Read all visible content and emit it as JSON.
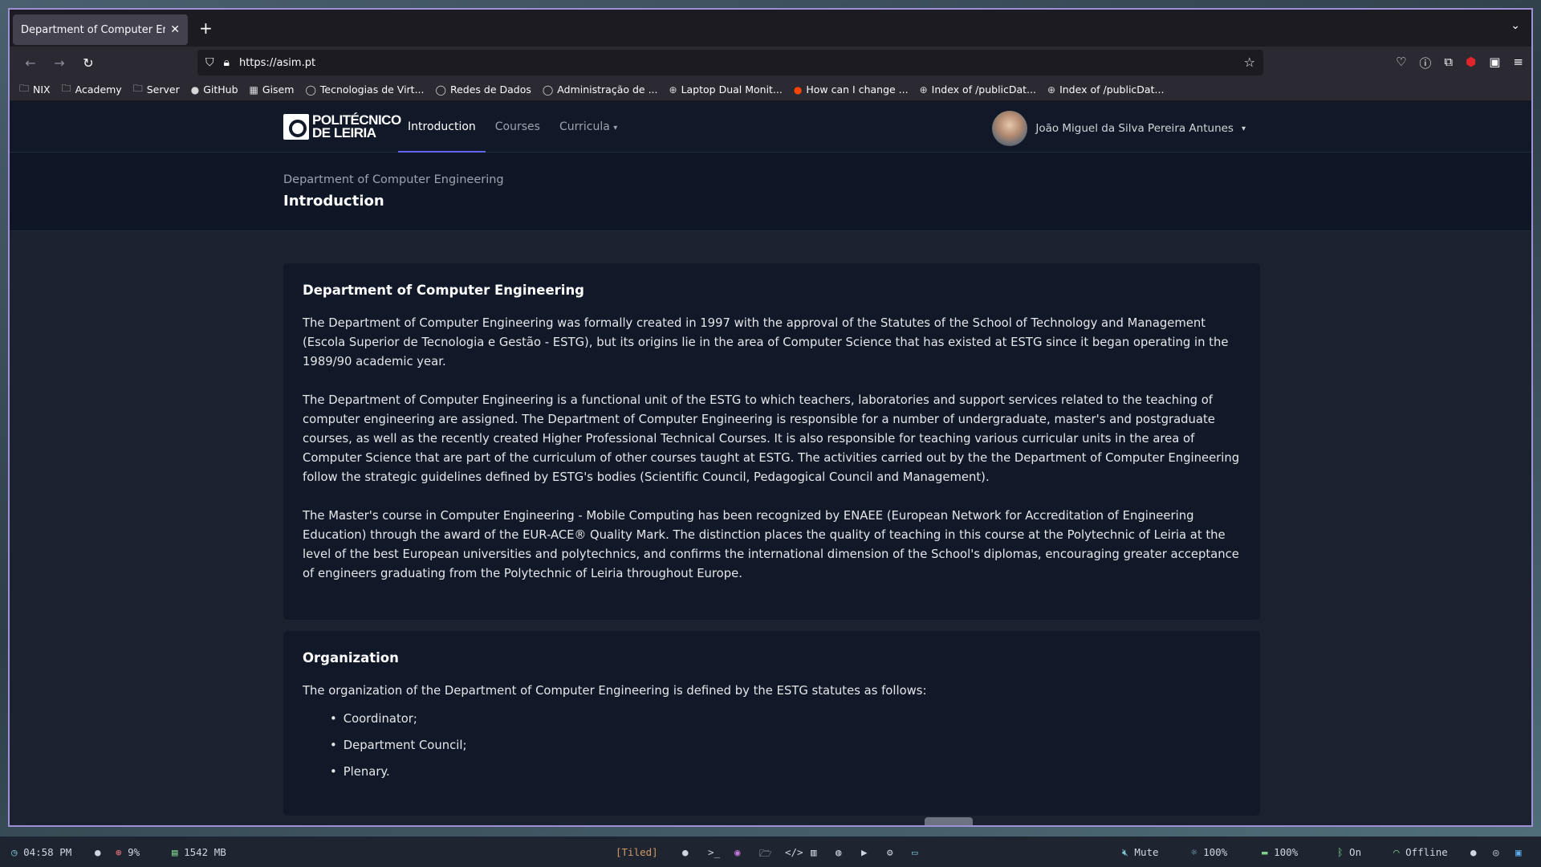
{
  "browser": {
    "tab_title": "Department of Computer Engin",
    "url": "https://asim.pt",
    "bookmarks": [
      {
        "label": "NIX",
        "icon": "folder-icon"
      },
      {
        "label": "Academy",
        "icon": "folder-icon"
      },
      {
        "label": "Server",
        "icon": "folder-icon"
      },
      {
        "label": "GitHub",
        "icon": "github-icon"
      },
      {
        "label": "Gisem",
        "icon": "calendar-icon"
      },
      {
        "label": "Tecnologias de Virt...",
        "icon": "circle-icon"
      },
      {
        "label": "Redes de Dados",
        "icon": "circle-icon"
      },
      {
        "label": "Administração de ...",
        "icon": "circle-icon"
      },
      {
        "label": "Laptop Dual Monit...",
        "icon": "globe-icon"
      },
      {
        "label": "How can I change ...",
        "icon": "reddit-icon"
      },
      {
        "label": "Index of /publicDat...",
        "icon": "globe-icon"
      },
      {
        "label": "Index of /publicDat...",
        "icon": "globe-icon"
      }
    ]
  },
  "site": {
    "logo_line1": "POLITÉCNICO",
    "logo_line2": "DE LEIRIA",
    "nav": [
      "Introduction",
      "Courses",
      "Curricula"
    ],
    "user_name": "João Miguel da Silva Pereira Antunes"
  },
  "header": {
    "breadcrumb": "Department of Computer Engineering",
    "title": "Introduction"
  },
  "cards": {
    "dept": {
      "title": "Department of Computer Engineering",
      "p1": "The Department of Computer Engineering was formally created in 1997 with the approval of the Statutes of the School of Technology and Management (Escola Superior de Tecnologia e Gestão - ESTG), but its origins lie in the area of Computer Science that has existed at ESTG since it began operating in the 1989/90 academic year.",
      "p2": "The Department of Computer Engineering is a functional unit of the ESTG to which teachers, laboratories and support services related to the teaching of computer engineering are assigned. The Department of Computer Engineering is responsible for a number of undergraduate, master's and postgraduate courses, as well as the recently created Higher Professional Technical Courses. It is also responsible for teaching various curricular units in the area of Computer Science that are part of the curriculum of other courses taught at ESTG. The activities carried out by the the Department of Computer Engineering follow the strategic guidelines defined by ESTG's bodies (Scientific Council, Pedagogical Council and Management).",
      "p3": "The Master's course in Computer Engineering - Mobile Computing has been recognized by ENAEE (European Network for Accreditation of Engineering Education) through the award of the EUR-ACE® Quality Mark. The distinction places the quality of teaching in this course at the Polytechnic of Leiria at the level of the best European universities and polytechnics, and confirms the international dimension of the School's diplomas, encouraging greater acceptance of engineers graduating from the Polytechnic of Leiria throughout Europe."
    },
    "org": {
      "title": "Organization",
      "intro": "The organization of the Department of Computer Engineering is defined by the ESTG statutes as follows:",
      "items": [
        "Coordinator;",
        "Department Council;",
        "Plenary."
      ]
    }
  },
  "statusbar": {
    "time": "04:58 PM",
    "cpu": "9%",
    "mem": "1542 MB",
    "layout": "[Tiled]",
    "volume": "Mute",
    "brightness": "100%",
    "battery": "100%",
    "bluetooth": "On",
    "network": "Offline"
  }
}
